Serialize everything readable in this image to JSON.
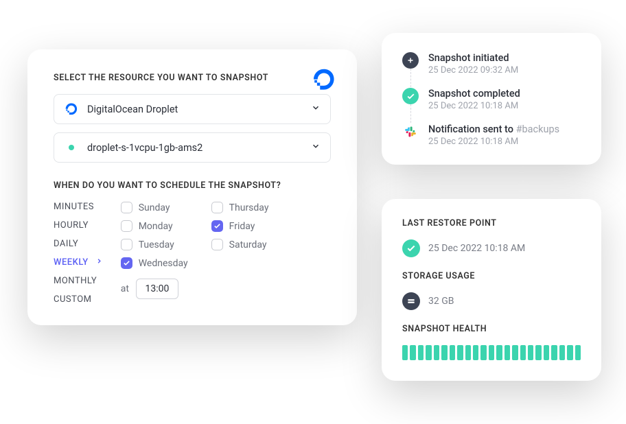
{
  "main": {
    "resource_heading": "SELECT THE RESOURCE YOU WANT TO SNAPSHOT",
    "provider": "DigitalOcean Droplet",
    "instance": "droplet-s-1vcpu-1gb-ams2",
    "schedule_heading": "WHEN DO YOU WANT TO SCHEDULE THE SNAPSHOT?",
    "freq": {
      "minutes": "MINUTES",
      "hourly": "HOURLY",
      "daily": "DAILY",
      "weekly": "WEEKLY",
      "monthly": "MONTHLY",
      "custom": "CUSTOM"
    },
    "days": {
      "sunday": "Sunday",
      "monday": "Monday",
      "tuesday": "Tuesday",
      "wednesday": "Wednesday",
      "thursday": "Thursday",
      "friday": "Friday",
      "saturday": "Saturday"
    },
    "at_label": "at",
    "time_value": "13:00"
  },
  "timeline": {
    "items": [
      {
        "title": "Snapshot initiated",
        "time": "25 Dec 2022 09:32 AM"
      },
      {
        "title": "Snapshot completed",
        "time": "25 Dec 2022 10:18 AM"
      },
      {
        "title": "Notification sent to ",
        "channel": "#backups",
        "time": "25 Dec 2022 10:18 AM"
      }
    ]
  },
  "status": {
    "restore_heading": "LAST RESTORE POINT",
    "restore_time": "25 Dec 2022 10:18 AM",
    "storage_heading": "STORAGE USAGE",
    "storage_value": "32 GB",
    "health_heading": "SNAPSHOT HEALTH",
    "health_segments": 23
  }
}
